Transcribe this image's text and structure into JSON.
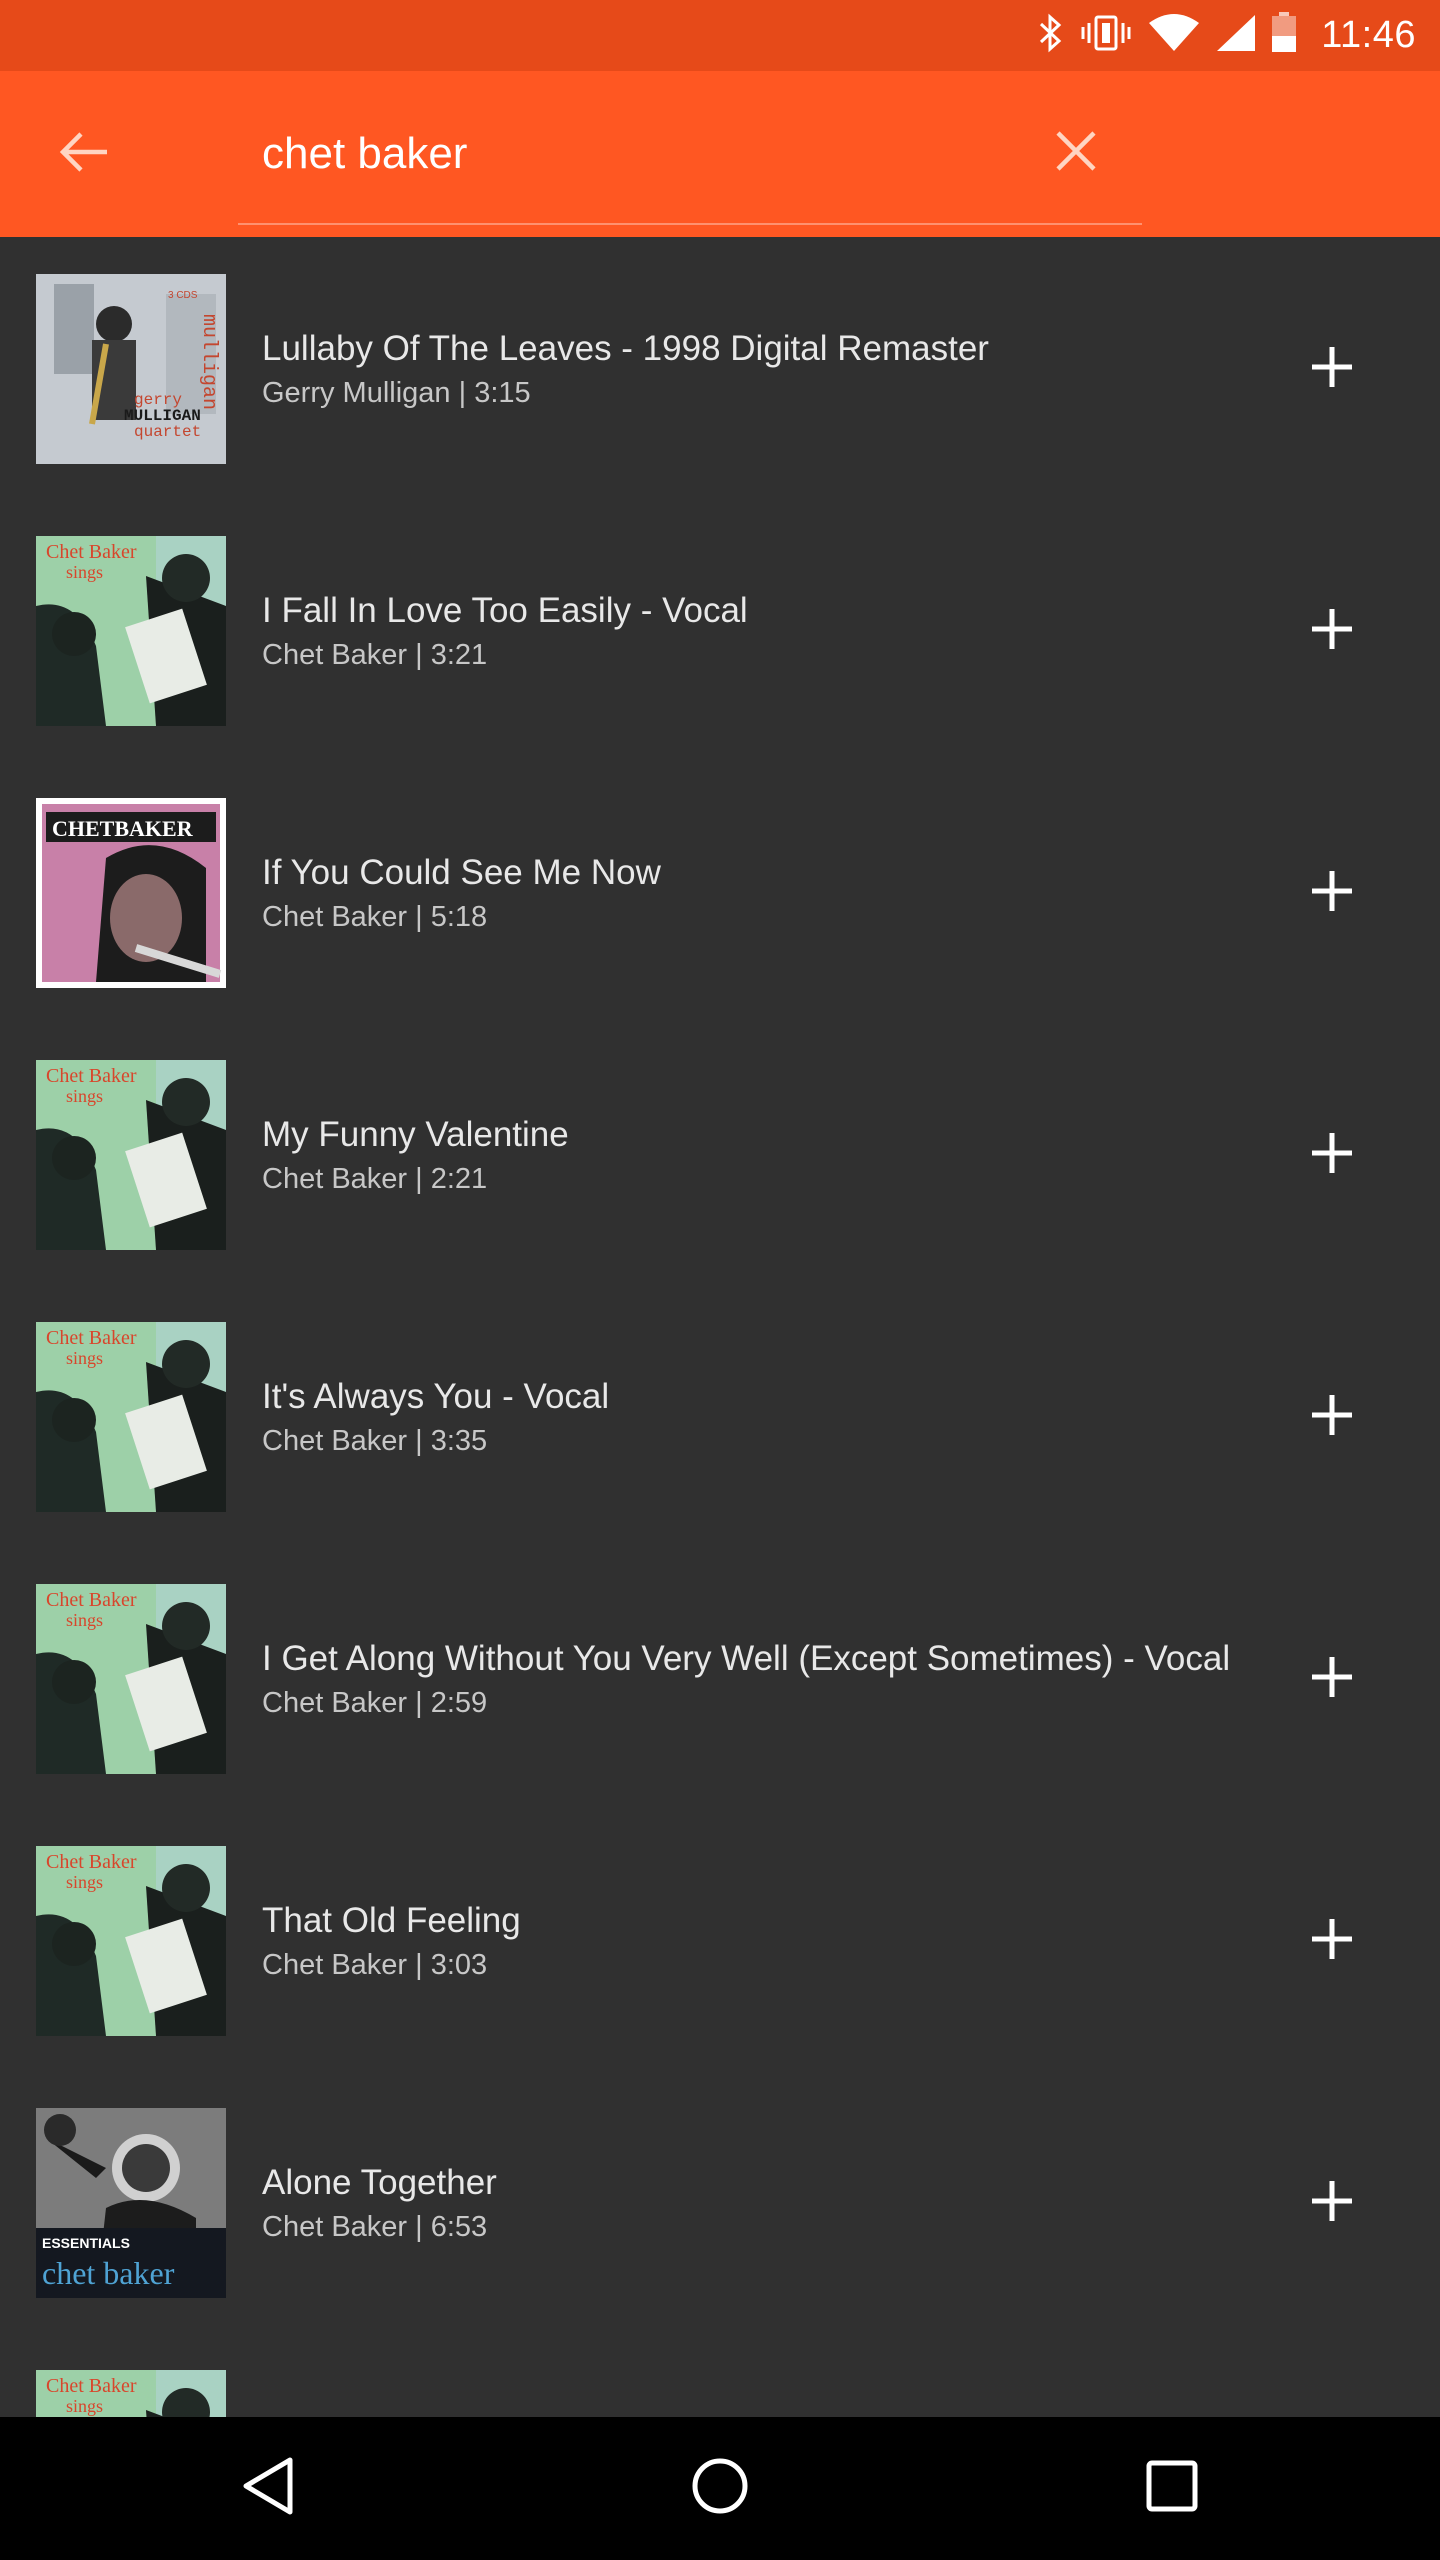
{
  "status_bar": {
    "time": "11:46",
    "icons": [
      "bluetooth-icon",
      "vibrate-icon",
      "wifi-icon",
      "cell-signal-icon",
      "battery-icon"
    ],
    "background": "#e64a19"
  },
  "app_bar": {
    "background": "#ff5722",
    "back_icon": "arrow-back-icon",
    "search_value": "chet baker",
    "clear_icon": "close-icon"
  },
  "results": [
    {
      "title": "Lullaby Of The Leaves - 1998 Digital Remaster",
      "subtitle": "Gerry Mulligan | 3:15",
      "art": "gerry-mulligan-quartet-cover",
      "art_text": [
        "gerry",
        "MULLIGAN",
        "quartet",
        "mulligan"
      ]
    },
    {
      "title": "I Fall In Love Too Easily - Vocal",
      "subtitle": "Chet Baker | 3:21",
      "art": "chet-baker-sings-cover",
      "art_text": [
        "Chet Baker",
        "sings"
      ]
    },
    {
      "title": "If You Could See Me Now",
      "subtitle": "Chet Baker | 5:18",
      "art": "chet-baker-pink-cover",
      "art_text": [
        "CHETBAKER"
      ]
    },
    {
      "title": "My Funny Valentine",
      "subtitle": "Chet Baker | 2:21",
      "art": "chet-baker-sings-cover",
      "art_text": [
        "Chet Baker",
        "sings"
      ]
    },
    {
      "title": "It's Always You - Vocal",
      "subtitle": "Chet Baker | 3:35",
      "art": "chet-baker-sings-cover",
      "art_text": [
        "Chet Baker",
        "sings"
      ]
    },
    {
      "title": "I Get Along Without You Very Well (Except Sometimes) - Vocal",
      "subtitle": "Chet Baker | 2:59",
      "art": "chet-baker-sings-cover",
      "art_text": [
        "Chet Baker",
        "sings"
      ]
    },
    {
      "title": "That Old Feeling",
      "subtitle": "Chet Baker | 3:03",
      "art": "chet-baker-sings-cover",
      "art_text": [
        "Chet Baker",
        "sings"
      ]
    },
    {
      "title": "Alone Together",
      "subtitle": "Chet Baker | 6:53",
      "art": "essentials-chet-baker-cover",
      "art_text": [
        "ESSENTIALS",
        "chet baker"
      ]
    },
    {
      "title": "",
      "subtitle": "",
      "art": "chet-baker-sings-cover",
      "art_text": [
        "Chet Baker",
        "sings"
      ]
    }
  ],
  "row_action_icon": "plus-icon",
  "nav_bar": {
    "buttons": [
      "back-triangle-icon",
      "home-circle-icon",
      "recents-square-icon"
    ]
  }
}
